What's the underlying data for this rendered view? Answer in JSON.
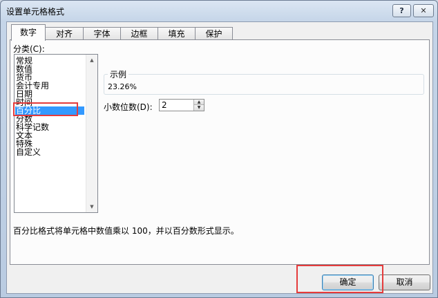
{
  "window": {
    "title": "设置单元格格式",
    "help_label": "?",
    "close_label": "✕"
  },
  "tabs": [
    {
      "label": "数字",
      "active": true
    },
    {
      "label": "对齐"
    },
    {
      "label": "字体"
    },
    {
      "label": "边框"
    },
    {
      "label": "填充"
    },
    {
      "label": "保护"
    }
  ],
  "category": {
    "label": "分类(C):",
    "items": [
      "常规",
      "数值",
      "货币",
      "会计专用",
      "日期",
      "时间",
      "百分比",
      "分数",
      "科学记数",
      "文本",
      "特殊",
      "自定义"
    ],
    "selected": "百分比"
  },
  "sample": {
    "legend": "示例",
    "value": "23.26%"
  },
  "decimal": {
    "label": "小数位数(D):",
    "value": "2"
  },
  "description": "百分比格式将单元格中数值乘以 100，并以百分数形式显示。",
  "buttons": {
    "ok": "确定",
    "cancel": "取消"
  },
  "colors": {
    "selection": "#3399ff",
    "highlight": "#e53b3b"
  }
}
